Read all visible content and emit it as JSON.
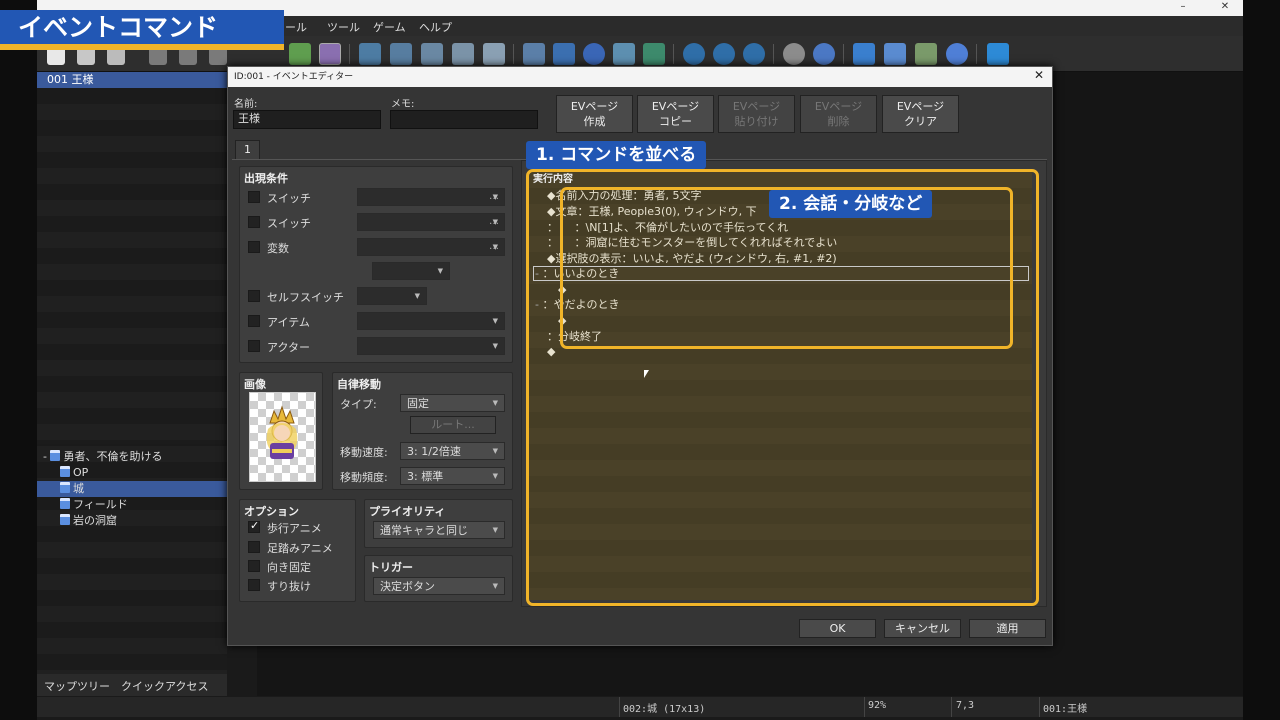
{
  "badge_title": "イベントコマンド",
  "menu": [
    "ール",
    "ツール",
    "ゲーム",
    "ヘルプ"
  ],
  "window_controls": [
    "–",
    "□",
    "✕"
  ],
  "map_list_selected": "001 王様",
  "map_tree": {
    "root": "勇者、不倫を助ける",
    "items": [
      "OP",
      "城",
      "フィールド",
      "岩の洞窟"
    ],
    "selected_index": 1
  },
  "left_tabs": [
    "マップツリー",
    "クイックアクセス"
  ],
  "status": [
    "002:城 (17x13)",
    "92%",
    "7,3",
    "001:王様"
  ],
  "dialog": {
    "title": "ID:001 - イベントエディター",
    "name_label": "名前:",
    "name_value": "王様",
    "memo_label": "メモ:",
    "memo_value": "",
    "page_buttons": [
      {
        "line1": "EVページ",
        "line2": "作成",
        "enabled": true
      },
      {
        "line1": "EVページ",
        "line2": "コピー",
        "enabled": true
      },
      {
        "line1": "EVページ",
        "line2": "貼り付け",
        "enabled": false
      },
      {
        "line1": "EVページ",
        "line2": "削除",
        "enabled": false
      },
      {
        "line1": "EVページ",
        "line2": "クリア",
        "enabled": true
      }
    ],
    "page_tab": "1",
    "conditions": {
      "title": "出現条件",
      "rows": [
        "スイッチ",
        "スイッチ",
        "変数",
        "セルフスイッチ",
        "アイテム",
        "アクター"
      ]
    },
    "image": {
      "title": "画像"
    },
    "autonomous": {
      "title": "自律移動",
      "type_label": "タイプ:",
      "type_value": "固定",
      "route_button": "ルート...",
      "speed_label": "移動速度:",
      "speed_value": "3: 1/2倍速",
      "freq_label": "移動頻度:",
      "freq_value": "3: 標準"
    },
    "options": {
      "title": "オプション",
      "items": [
        {
          "label": "歩行アニメ",
          "checked": true
        },
        {
          "label": "足踏みアニメ",
          "checked": false
        },
        {
          "label": "向き固定",
          "checked": false
        },
        {
          "label": "すり抜け",
          "checked": false
        }
      ]
    },
    "priority": {
      "title": "プライオリティ",
      "value": "通常キャラと同じ"
    },
    "trigger": {
      "title": "トリガー",
      "value": "決定ボタン"
    },
    "contents_title": "実行内容",
    "commands": [
      "◆名前入力の処理：勇者, 5文字",
      "◆文章：王様, People3(0), ウィンドウ, 下",
      "：　　：\\N[1]よ、不倫がしたいので手伝ってくれ",
      "：　　：洞窟に住むモンスターを倒してくれればそれでよい",
      "◆選択肢の表示：いいよ, やだよ (ウィンドウ, 右, #1, #2)",
      "：いいよのとき",
      "　◆",
      "：やだよのとき",
      "　◆",
      "：分岐終了",
      "◆"
    ],
    "footer": [
      "OK",
      "キャンセル",
      "適用"
    ]
  },
  "annotations": [
    "1. コマンドを並べる",
    "2. 会話・分岐など"
  ]
}
